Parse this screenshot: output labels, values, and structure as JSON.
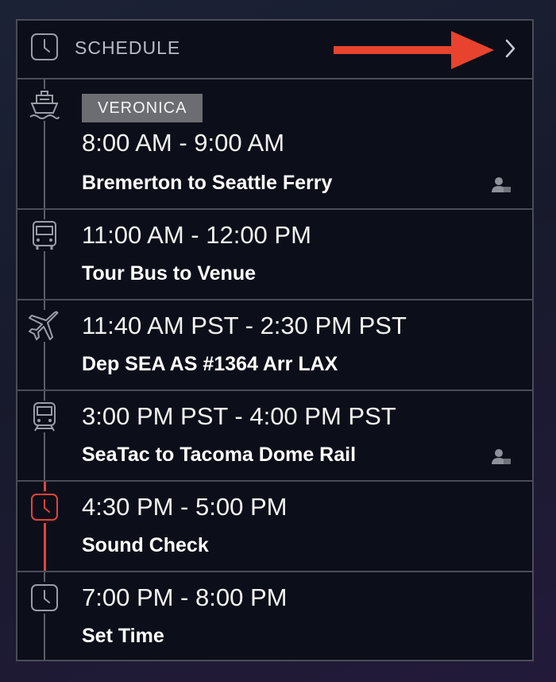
{
  "header": {
    "title": "SCHEDULE",
    "clock_icon": "clock-icon",
    "next_icon": "chevron-right-icon",
    "annotation_arrow_color": "#e8432f"
  },
  "colors": {
    "panel_bg": "#0c0f19",
    "border": "#4a4d57",
    "timeline_active": "#e0453a"
  },
  "items": [
    {
      "tag": "VERONICA",
      "time": "8:00 AM - 9:00 AM",
      "name": "Bremerton to Seattle Ferry",
      "icon": "ferry-icon",
      "has_person": true
    },
    {
      "time": "11:00 AM - 12:00 PM",
      "name": "Tour Bus to Venue",
      "icon": "bus-icon",
      "has_person": false
    },
    {
      "time": "11:40 AM PST - 2:30 PM PST",
      "name": "Dep SEA AS #1364 Arr LAX",
      "icon": "plane-icon",
      "has_person": false
    },
    {
      "time": "3:00 PM PST - 4:00 PM PST",
      "name": "SeaTac to Tacoma Dome Rail",
      "icon": "train-icon",
      "has_person": true
    },
    {
      "time": "4:30 PM - 5:00 PM",
      "name": "Sound Check",
      "icon": "clock-icon",
      "has_person": false,
      "active": true
    },
    {
      "time": "7:00 PM - 8:00 PM",
      "name": "Set Time",
      "icon": "clock-icon",
      "has_person": false
    }
  ]
}
